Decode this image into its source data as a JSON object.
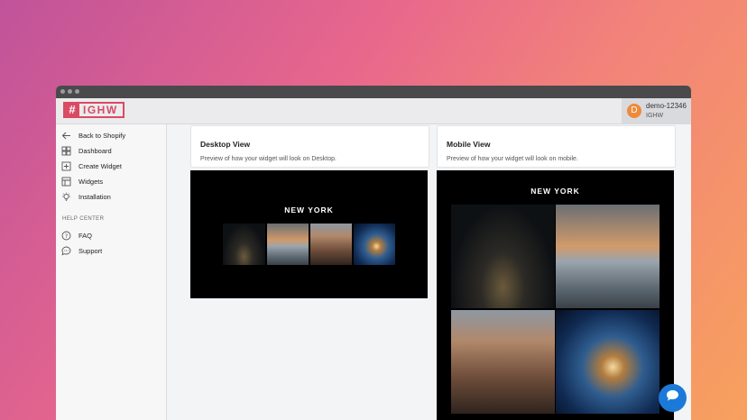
{
  "brand": {
    "hash": "#",
    "name": "IGHW",
    "color": "#d94a63"
  },
  "account": {
    "initial": "D",
    "name": "demo-12346",
    "shop": "IGHW"
  },
  "sidebar": {
    "items": [
      {
        "label": "Back to Shopify",
        "icon": "arrow-left-icon"
      },
      {
        "label": "Dashboard",
        "icon": "dashboard-icon"
      },
      {
        "label": "Create Widget",
        "icon": "plus-square-icon"
      },
      {
        "label": "Widgets",
        "icon": "widgets-icon"
      },
      {
        "label": "Installation",
        "icon": "lightbulb-icon"
      }
    ],
    "help_label": "HELP CENTER",
    "help_items": [
      {
        "label": "FAQ",
        "icon": "question-icon"
      },
      {
        "label": "Support",
        "icon": "chat-icon"
      }
    ]
  },
  "desktop": {
    "title": "Desktop View",
    "desc": "Preview of how your widget will look on Desktop.",
    "preview_title": "NEW YORK"
  },
  "mobile": {
    "title": "Mobile View",
    "desc": "Preview of how your widget will look on mobile.",
    "preview_title": "NEW YORK"
  },
  "colors": {
    "chat": "#1b7ad9",
    "avatar": "#ee8a3a"
  }
}
